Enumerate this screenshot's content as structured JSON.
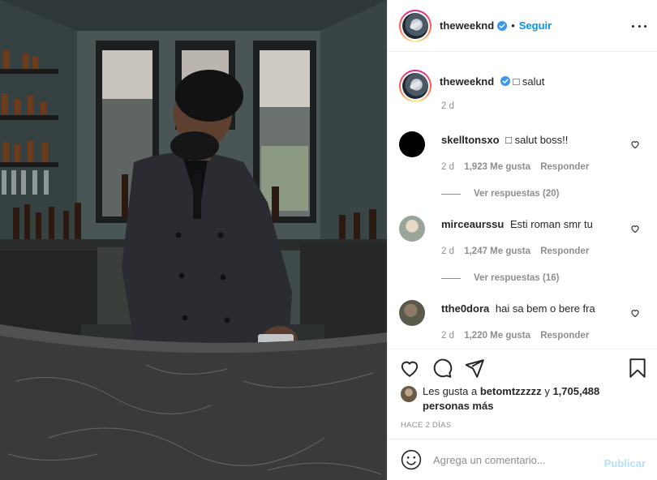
{
  "post": {
    "image_alt": "Man in dark coat standing at marble bar holding a glass",
    "author": {
      "username": "theweeknd",
      "verified": true,
      "follow_label": "Seguir",
      "separator": "•"
    },
    "caption": {
      "username": "theweeknd",
      "text": "□ salut",
      "time": "2 d"
    },
    "comments": [
      {
        "username": "skelltonsxo",
        "text": "□ salut boss!!",
        "time": "2 d",
        "likes": "1,923 Me gusta",
        "reply_label": "Responder",
        "replies_label": "Ver respuestas (20)",
        "avatar_color": "#000000"
      },
      {
        "username": "mirceaurssu",
        "text": "Esti roman smr tu",
        "time": "2 d",
        "likes": "1,247 Me gusta",
        "reply_label": "Responder",
        "replies_label": "Ver respuestas (16)",
        "avatar_color": "#9aa59a"
      },
      {
        "username": "tthe0dora",
        "text": "hai sa bem o bere fra",
        "time": "2 d",
        "likes": "1,220 Me gusta",
        "reply_label": "Responder",
        "avatar_color": "#5a5a4c"
      }
    ],
    "likes": {
      "prefix": "Les gusta a",
      "user": "betomtzzzzz",
      "joiner": "y",
      "others": "1,705,488 personas más"
    },
    "time_ago": "HACE 2 DÍAS",
    "add_comment": {
      "placeholder": "Agrega un comentario...",
      "publish_label": "Publicar"
    },
    "icons": {
      "like": "heart-icon",
      "comment": "comment-icon",
      "share": "share-icon",
      "save": "bookmark-icon",
      "options": "more-options-icon",
      "emoji": "emoji-icon"
    },
    "colors": {
      "link": "#0095f6",
      "muted": "#8e8e8e",
      "publish_disabled": "#b2dffc",
      "verified": "#3897f0"
    }
  }
}
